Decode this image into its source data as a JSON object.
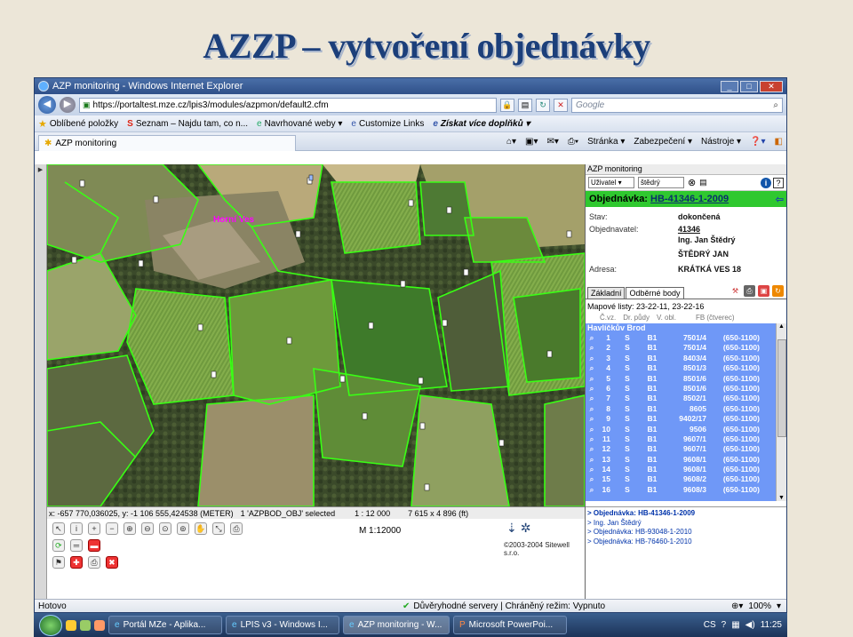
{
  "slide": {
    "title": "AZZP – vytvoření objednávky"
  },
  "window": {
    "title": "AZP monitoring - Windows Internet Explorer"
  },
  "address": {
    "url": "https://portaltest.mze.cz/lpis3/modules/azpmon/default2.cfm",
    "search_placeholder": "Google"
  },
  "favorites": [
    {
      "label": "Oblíbené položky"
    },
    {
      "label": "Seznam – Najdu tam, co n..."
    },
    {
      "label": "Navrhované weby ▾"
    },
    {
      "label": "Customize Links"
    },
    {
      "label": "Získat více doplňků ▾"
    }
  ],
  "tab": {
    "label": "AZP monitoring"
  },
  "commands": {
    "page": "Stránka ▾",
    "safety": "Zabezpečení ▾",
    "tools": "Nástroje ▾"
  },
  "map": {
    "village_label": "Horní Ves",
    "coords": "x: -657 770,036025, y: -1 106 555,424538 (METER)",
    "selection": "1 'AZPBOD_OBJ' selected",
    "scale_ratio": "1 : 12 000",
    "extent": "7 615 x 4 896 (ft)",
    "scale_label": "M 1:12000",
    "copyright": "©2003-2004 Sitewell s.r.o."
  },
  "panel": {
    "header": "AZP monitoring",
    "user_select": "Uživatel",
    "user_value": "štědrý",
    "order_label": "Objednávka:",
    "order_number": "HB-41346-1-2009",
    "status_label": "Stav:",
    "status_value": "dokončená",
    "customer_label": "Objednavatel:",
    "customer_id": "41346",
    "customer_name": "Ing. Jan Štědrý",
    "customer_name2": "ŠTĚDRÝ JAN",
    "address_label": "Adresa:",
    "address_value": "KRÁTKÁ VES 18",
    "tab_basic": "Základní",
    "tab_samples": "Odběrné body",
    "sheets": "Mapové listy: 23-22-11, 23-22-16",
    "col_headers": [
      "Č.vz.",
      "Dr. půdy",
      "V. obl.",
      "FB (čtverec)"
    ],
    "group": "Havlíčkův Brod",
    "rows": [
      {
        "n": "1",
        "s": "S",
        "b": "B1",
        "fb": "7501/4",
        "rg": "(650-1100)"
      },
      {
        "n": "2",
        "s": "S",
        "b": "B1",
        "fb": "7501/4",
        "rg": "(650-1100)"
      },
      {
        "n": "3",
        "s": "S",
        "b": "B1",
        "fb": "8403/4",
        "rg": "(650-1100)"
      },
      {
        "n": "4",
        "s": "S",
        "b": "B1",
        "fb": "8501/3",
        "rg": "(650-1100)"
      },
      {
        "n": "5",
        "s": "S",
        "b": "B1",
        "fb": "8501/6",
        "rg": "(650-1100)"
      },
      {
        "n": "6",
        "s": "S",
        "b": "B1",
        "fb": "8501/6",
        "rg": "(650-1100)"
      },
      {
        "n": "7",
        "s": "S",
        "b": "B1",
        "fb": "8502/1",
        "rg": "(650-1100)"
      },
      {
        "n": "8",
        "s": "S",
        "b": "B1",
        "fb": "8605",
        "rg": "(650-1100)"
      },
      {
        "n": "9",
        "s": "S",
        "b": "B1",
        "fb": "9402/17",
        "rg": "(650-1100)"
      },
      {
        "n": "10",
        "s": "S",
        "b": "B1",
        "fb": "9506",
        "rg": "(650-1100)"
      },
      {
        "n": "11",
        "s": "S",
        "b": "B1",
        "fb": "9607/1",
        "rg": "(650-1100)"
      },
      {
        "n": "12",
        "s": "S",
        "b": "B1",
        "fb": "9607/1",
        "rg": "(650-1100)"
      },
      {
        "n": "13",
        "s": "S",
        "b": "B1",
        "fb": "9608/1",
        "rg": "(650-1100)"
      },
      {
        "n": "14",
        "s": "S",
        "b": "B1",
        "fb": "9608/1",
        "rg": "(650-1100)"
      },
      {
        "n": "15",
        "s": "S",
        "b": "B1",
        "fb": "9608/2",
        "rg": "(650-1100)"
      },
      {
        "n": "16",
        "s": "S",
        "b": "B1",
        "fb": "9608/3",
        "rg": "(650-1100)"
      }
    ],
    "links": [
      "> Objednávka: HB-41346-1-2009",
      "> Ing. Jan Štědrý",
      "> Objednávka: HB-93048-1-2010",
      "> Objednávka: HB-76460-1-2010"
    ]
  },
  "status": {
    "left": "Hotovo",
    "trusted": "Důvěryhodné servery | Chráněný režim: Vypnuto",
    "zoom": "100%"
  },
  "taskbar": {
    "tasks": [
      "Portál MZe - Aplika...",
      "LPIS v3 - Windows I...",
      "AZP monitoring - W...",
      "Microsoft PowerPoi..."
    ],
    "lang": "CS",
    "clock": "11:25"
  }
}
